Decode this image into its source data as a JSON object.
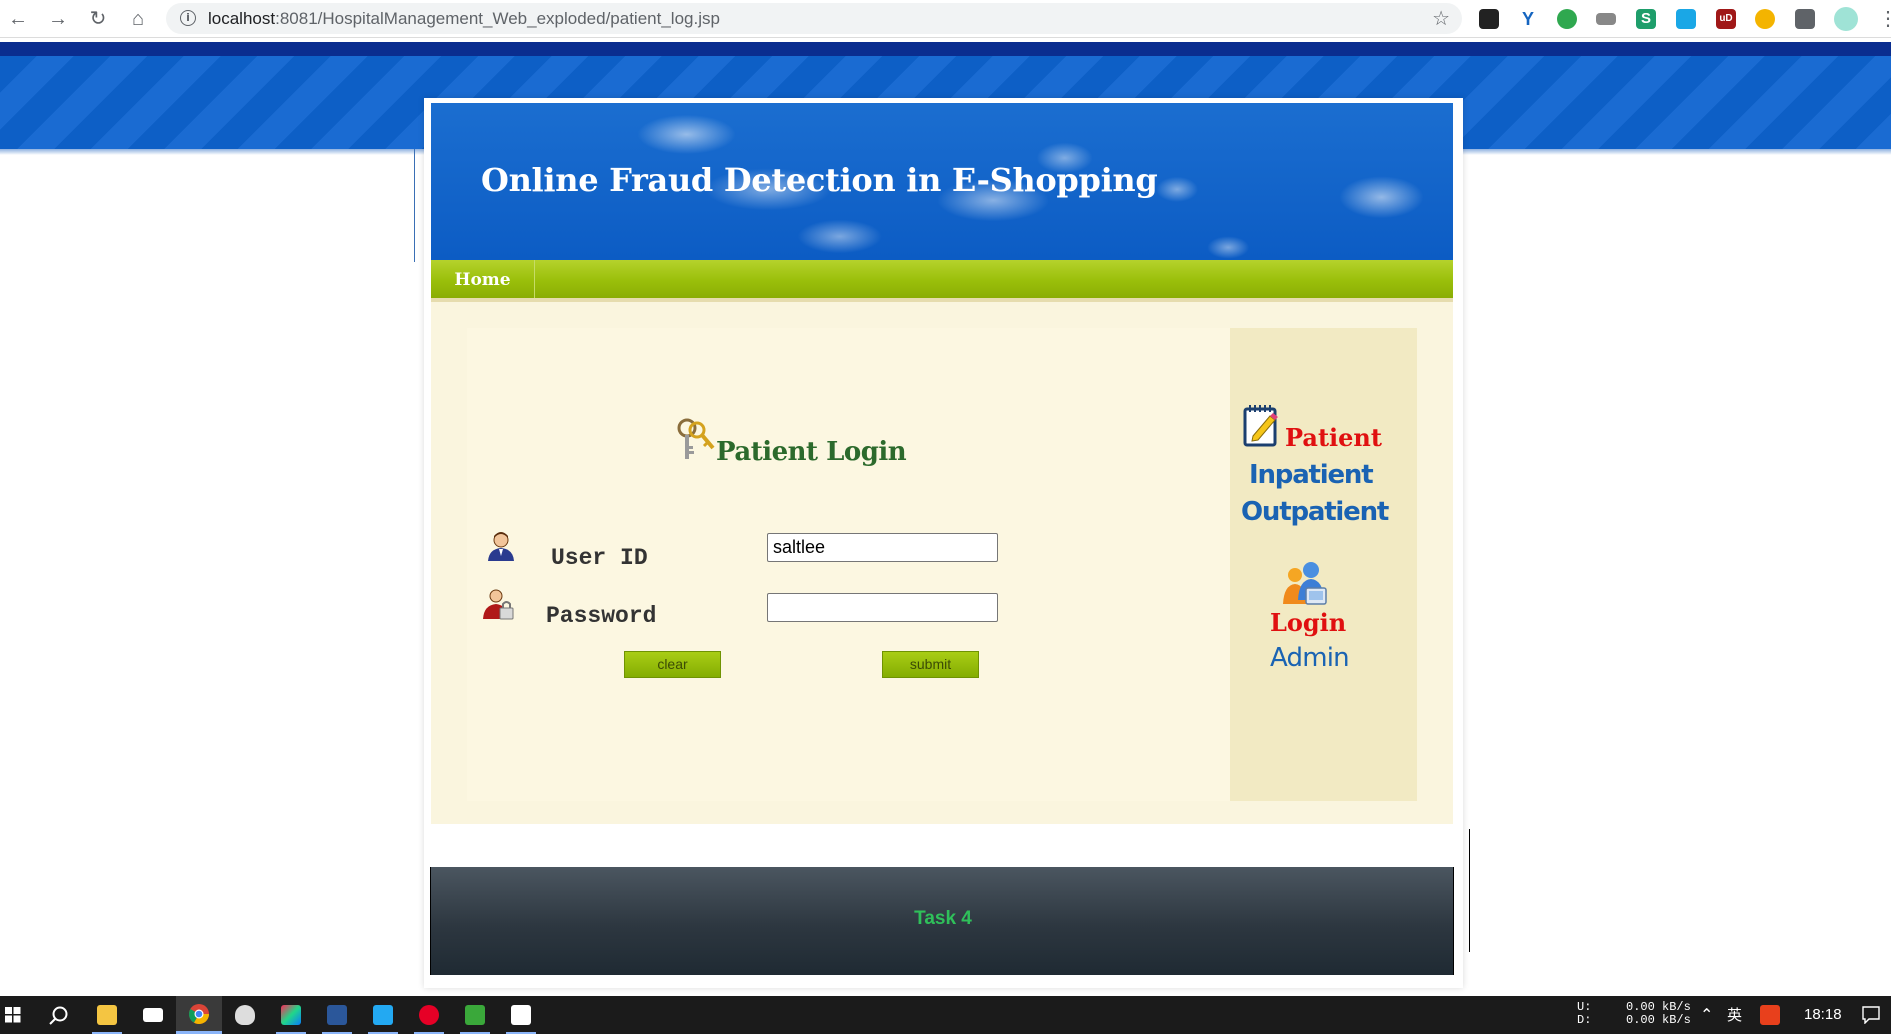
{
  "browser": {
    "url_host": "localhost",
    "url_rest": ":8081/HospitalManagement_Web_exploded/patient_log.jsp"
  },
  "site": {
    "title": "Online Fraud Detection in E-Shopping",
    "nav": {
      "home_label": "Home"
    }
  },
  "login": {
    "title": "Patient Login",
    "user_label": "User ID",
    "user_value": "saltlee",
    "password_label": "Password",
    "password_value": "",
    "clear_label": "clear",
    "submit_label": "submit"
  },
  "sidebar": {
    "patient_heading": "Patient",
    "links": [
      "Inpatient",
      "Outpatient"
    ],
    "login_heading": "Login",
    "admin_link": "Admin"
  },
  "footer": {
    "text": "Task 4"
  },
  "taskbar": {
    "net_up_label": "U:",
    "net_down_label": "D:",
    "net_up": "0.00 kB/s",
    "net_down": "0.00 kB/s",
    "ime": "英",
    "clock": "18:18"
  },
  "colors": {
    "header_blue": "#0c5cc4",
    "nav_green": "#9abf0a",
    "sidebar_red": "#e01010",
    "sidebar_blue": "#1a63b3",
    "footer_green": "#2fc05a"
  }
}
